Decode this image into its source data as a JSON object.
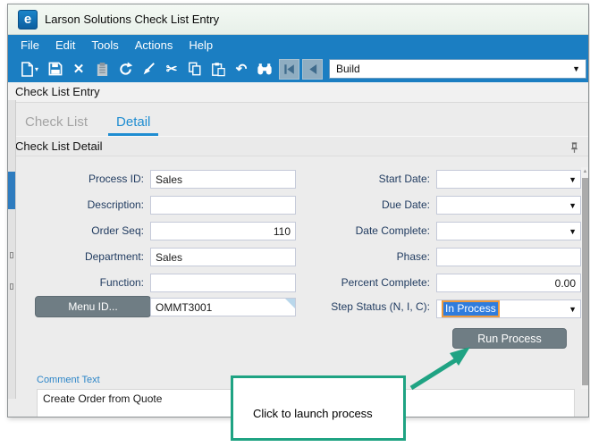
{
  "window": {
    "title": "Larson Solutions Check List Entry",
    "logo_letter": "e"
  },
  "menu_bar": {
    "items": {
      "file": "File",
      "edit": "Edit",
      "tools": "Tools",
      "actions": "Actions",
      "help": "Help"
    }
  },
  "toolbar": {
    "icon_names": [
      "new-icon",
      "save-icon",
      "delete-icon",
      "attachments-icon",
      "refresh-icon",
      "clear-icon",
      "cut-icon",
      "copy-icon",
      "paste-icon",
      "undo-icon",
      "search-icon",
      "first-record-icon",
      "previous-record-icon"
    ],
    "view_dropdown": {
      "value": "Build"
    }
  },
  "panel_header": {
    "title": "Check List Entry"
  },
  "tabs": {
    "check_list": "Check List",
    "detail": "Detail"
  },
  "detail_header": {
    "title": "Check List Detail"
  },
  "form": {
    "process_id": {
      "label": "Process ID:",
      "value": "Sales"
    },
    "description": {
      "label": "Description:",
      "value": ""
    },
    "order_seq": {
      "label": "Order Seq:",
      "value": "110"
    },
    "department": {
      "label": "Department:",
      "value": "Sales"
    },
    "function": {
      "label": "Function:",
      "value": ""
    },
    "menu_id": {
      "button_label": "Menu ID...",
      "value": "OMMT3001"
    },
    "start_date": {
      "label": "Start Date:",
      "value": ""
    },
    "due_date": {
      "label": "Due Date:",
      "value": ""
    },
    "date_complete": {
      "label": "Date Complete:",
      "value": ""
    },
    "phase": {
      "label": "Phase:",
      "value": ""
    },
    "percent_complete": {
      "label": "Percent Complete:",
      "value": "0.00"
    },
    "step_status": {
      "label": "Step Status (N, I, C):",
      "value": "In Process"
    },
    "run_button_label": "Run Process",
    "comment": {
      "label": "Comment Text",
      "value": "Create Order from Quote"
    }
  },
  "annotation": {
    "callout_text": "Click to launch process"
  },
  "icons": {
    "delete": "✕",
    "cut": "✂",
    "undo": "↶",
    "caret_down": "▾",
    "dropdown_arrow": "▼",
    "scroll_up": "▲"
  },
  "colors": {
    "toolbar_blue": "#1b7ec2",
    "tab_active_blue": "#1f8dd1",
    "button_gray": "#6f7d84",
    "callout_green": "#1fa383",
    "selection_blue": "#2f7cdd",
    "selection_focus_orange": "#ed9b40",
    "label_navy": "#1f3a5f"
  }
}
